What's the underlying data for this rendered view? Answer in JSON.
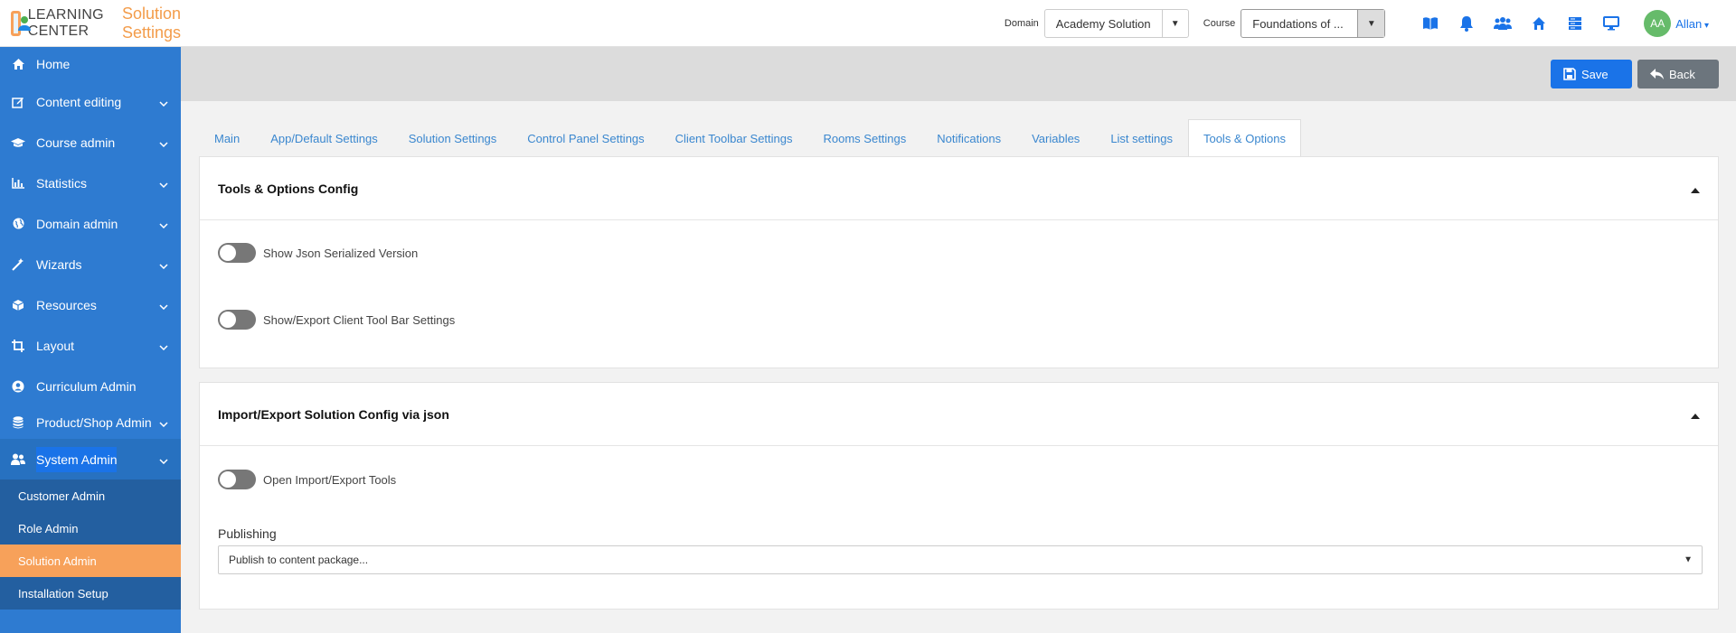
{
  "app": {
    "name": "LEARNING CENTER",
    "page_title": "Solution Settings"
  },
  "header": {
    "domain_label": "Domain",
    "domain_value": "Academy Solution",
    "course_label": "Course",
    "course_value": "Foundations of ...",
    "avatar_initials": "AA",
    "user_name": "Allan"
  },
  "sidebar": {
    "items": [
      {
        "label": "Home",
        "icon": "home-icon"
      },
      {
        "label": "Content editing",
        "icon": "edit-icon"
      },
      {
        "label": "Course admin",
        "icon": "graduation-cap-icon"
      },
      {
        "label": "Statistics",
        "icon": "bar-chart-icon"
      },
      {
        "label": "Domain admin",
        "icon": "globe-icon"
      },
      {
        "label": "Wizards",
        "icon": "magic-wand-icon"
      },
      {
        "label": "Resources",
        "icon": "cube-icon"
      },
      {
        "label": "Layout",
        "icon": "crop-icon"
      },
      {
        "label": "Curriculum Admin",
        "icon": "user-circle-icon"
      },
      {
        "label": "Product/Shop Admin",
        "icon": "database-icon"
      },
      {
        "label": "System Admin",
        "icon": "users-icon"
      }
    ],
    "sub_items": [
      "Customer Admin",
      "Role Admin",
      "Solution Admin",
      "Installation Setup"
    ]
  },
  "toolbar": {
    "save_label": "Save",
    "back_label": "Back"
  },
  "tabs": [
    "Main",
    "App/Default Settings",
    "Solution Settings",
    "Control Panel Settings",
    "Client Toolbar Settings",
    "Rooms Settings",
    "Notifications",
    "Variables",
    "List settings",
    "Tools & Options"
  ],
  "card1": {
    "title": "Tools & Options Config",
    "toggles": [
      "Show Json Serialized Version",
      "Show/Export Client Tool Bar Settings"
    ]
  },
  "card2": {
    "title": "Import/Export Solution Config via json",
    "toggle": "Open Import/Export Tools",
    "publishing_label": "Publishing",
    "publishing_value": "Publish to content package..."
  },
  "colors": {
    "sidebar": "#2e7bd1",
    "accent": "#f7a15a",
    "primary": "#1a73e8"
  }
}
